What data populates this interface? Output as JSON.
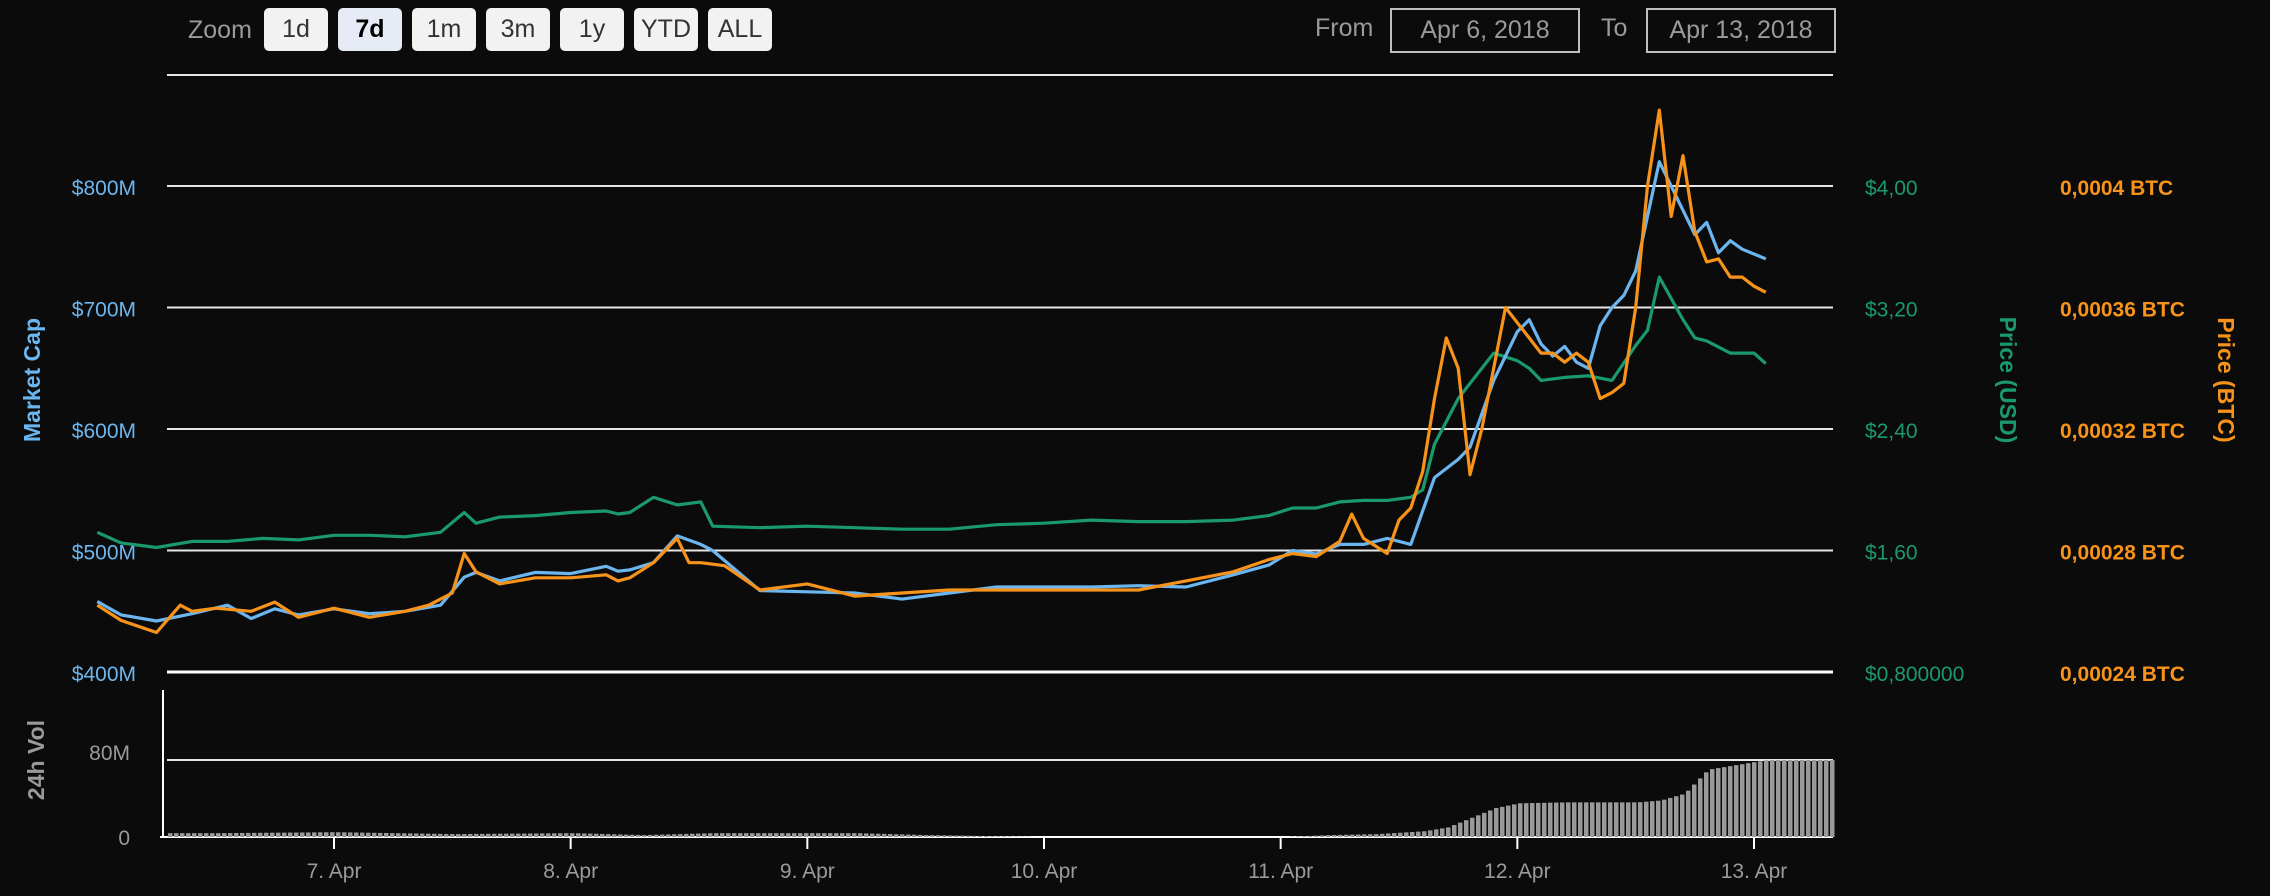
{
  "toolbar": {
    "zoom_label": "Zoom",
    "zoom_buttons": [
      "1d",
      "7d",
      "1m",
      "3m",
      "1y",
      "YTD",
      "ALL"
    ],
    "active_zoom": "7d",
    "from_label": "From",
    "from_value": "Apr 6, 2018",
    "to_label": "To",
    "to_value": "Apr 13, 2018"
  },
  "colors": {
    "market_cap": "#6cb6f0",
    "price_usd": "#1a9a6c",
    "price_btc": "#f7931a",
    "volume": "#9a9a9a",
    "grid": "#e6e6e6",
    "background": "#0b0b0b"
  },
  "chart_data": [
    {
      "type": "line",
      "x_labels": [
        "7. Apr",
        "8. Apr",
        "9. Apr",
        "10. Apr",
        "11. Apr",
        "12. Apr",
        "13. Apr"
      ],
      "x_range": [
        "Apr 6, 2018 07:00",
        "Apr 13, 2018 08:00"
      ],
      "axes": {
        "market_cap": {
          "label": "Market Cap",
          "ticks": [
            "$400M",
            "$500M",
            "$600M",
            "$700M",
            "$800M"
          ],
          "range": [
            400,
            900
          ],
          "unit": "M USD"
        },
        "price_usd": {
          "label": "Price (USD)",
          "ticks": [
            "$0,800000",
            "$1,60",
            "$2,40",
            "$3,20",
            "$4,00"
          ],
          "range": [
            0.8,
            4.8
          ]
        },
        "price_btc": {
          "label": "Price (BTC)",
          "ticks": [
            "0,00024 BTC",
            "0,00028 BTC",
            "0,00032 BTC",
            "0,00036 BTC",
            "0,0004 BTC"
          ],
          "range": [
            0.00024,
            0.00044
          ]
        }
      },
      "series": [
        {
          "name": "Market Cap",
          "key": "market_cap",
          "x": [
            0,
            0.1,
            0.25,
            0.4,
            0.55,
            0.65,
            0.75,
            0.85,
            1.0,
            1.15,
            1.3,
            1.45,
            1.55,
            1.6,
            1.7,
            1.85,
            2.0,
            2.15,
            2.2,
            2.25,
            2.35,
            2.45,
            2.55,
            2.6,
            2.8,
            3.0,
            3.2,
            3.4,
            3.6,
            3.8,
            4.0,
            4.2,
            4.4,
            4.6,
            4.8,
            4.95,
            5.05,
            5.15,
            5.25,
            5.35,
            5.45,
            5.55,
            5.65,
            5.75,
            5.8,
            5.9,
            6.0,
            6.05,
            6.1,
            6.15,
            6.2,
            6.25,
            6.3,
            6.35,
            6.4,
            6.45,
            6.5,
            6.6,
            6.7,
            6.75,
            6.8,
            6.85,
            6.9,
            6.95,
            7.0,
            7.05
          ],
          "values": [
            458,
            447,
            442,
            448,
            455,
            444,
            452,
            447,
            452,
            448,
            450,
            455,
            478,
            482,
            475,
            482,
            481,
            487,
            483,
            484,
            490,
            512,
            505,
            500,
            467,
            466,
            465,
            460,
            465,
            470,
            470,
            470,
            471,
            470,
            480,
            488,
            500,
            497,
            505,
            505,
            510,
            505,
            560,
            575,
            585,
            640,
            680,
            690,
            670,
            660,
            668,
            655,
            650,
            685,
            700,
            710,
            730,
            820,
            780,
            760,
            770,
            745,
            755,
            748,
            744,
            740
          ]
        },
        {
          "name": "Price (USD)",
          "key": "price_usd",
          "x": [
            0,
            0.1,
            0.25,
            0.4,
            0.55,
            0.7,
            0.85,
            1.0,
            1.15,
            1.3,
            1.45,
            1.55,
            1.6,
            1.7,
            1.85,
            2.0,
            2.15,
            2.2,
            2.25,
            2.35,
            2.45,
            2.55,
            2.6,
            2.8,
            3.0,
            3.2,
            3.4,
            3.6,
            3.8,
            4.0,
            4.2,
            4.4,
            4.6,
            4.8,
            4.95,
            5.05,
            5.15,
            5.25,
            5.35,
            5.45,
            5.55,
            5.6,
            5.65,
            5.75,
            5.8,
            5.9,
            6.0,
            6.05,
            6.1,
            6.2,
            6.3,
            6.4,
            6.5,
            6.55,
            6.6,
            6.7,
            6.75,
            6.8,
            6.9,
            7.0,
            7.05
          ],
          "values": [
            1.72,
            1.65,
            1.62,
            1.66,
            1.66,
            1.68,
            1.67,
            1.7,
            1.7,
            1.69,
            1.72,
            1.85,
            1.78,
            1.82,
            1.83,
            1.85,
            1.86,
            1.84,
            1.85,
            1.95,
            1.9,
            1.92,
            1.76,
            1.75,
            1.76,
            1.75,
            1.74,
            1.74,
            1.77,
            1.78,
            1.8,
            1.79,
            1.79,
            1.8,
            1.83,
            1.88,
            1.88,
            1.92,
            1.93,
            1.93,
            1.95,
            2.0,
            2.3,
            2.6,
            2.7,
            2.9,
            2.85,
            2.8,
            2.72,
            2.74,
            2.75,
            2.72,
            2.95,
            3.05,
            3.4,
            3.12,
            3.0,
            2.98,
            2.9,
            2.9,
            2.83
          ]
        },
        {
          "name": "Price (BTC)",
          "key": "price_btc",
          "x": [
            0,
            0.1,
            0.25,
            0.35,
            0.4,
            0.5,
            0.65,
            0.75,
            0.85,
            1.0,
            1.15,
            1.3,
            1.4,
            1.5,
            1.55,
            1.6,
            1.7,
            1.85,
            2.0,
            2.15,
            2.2,
            2.25,
            2.35,
            2.45,
            2.5,
            2.55,
            2.65,
            2.8,
            3.0,
            3.2,
            3.4,
            3.6,
            3.8,
            4.0,
            4.2,
            4.4,
            4.6,
            4.8,
            4.95,
            5.05,
            5.15,
            5.25,
            5.3,
            5.35,
            5.45,
            5.5,
            5.55,
            5.6,
            5.65,
            5.7,
            5.75,
            5.8,
            5.85,
            5.9,
            5.95,
            6.0,
            6.05,
            6.1,
            6.15,
            6.2,
            6.25,
            6.3,
            6.35,
            6.4,
            6.45,
            6.5,
            6.55,
            6.6,
            6.65,
            6.7,
            6.75,
            6.8,
            6.85,
            6.9,
            6.95,
            7.0,
            7.05
          ],
          "values": [
            0.000262,
            0.000257,
            0.000253,
            0.000262,
            0.00026,
            0.000261,
            0.00026,
            0.000263,
            0.000258,
            0.000261,
            0.000258,
            0.00026,
            0.000262,
            0.000266,
            0.000279,
            0.000273,
            0.000269,
            0.000271,
            0.000271,
            0.000272,
            0.00027,
            0.000271,
            0.000276,
            0.000284,
            0.000276,
            0.000276,
            0.000275,
            0.000267,
            0.000269,
            0.000265,
            0.000266,
            0.000267,
            0.000267,
            0.000267,
            0.000267,
            0.000267,
            0.00027,
            0.000273,
            0.000277,
            0.000279,
            0.000278,
            0.000283,
            0.000292,
            0.000284,
            0.000279,
            0.00029,
            0.000294,
            0.000306,
            0.00033,
            0.00035,
            0.00034,
            0.000305,
            0.00032,
            0.00034,
            0.00036,
            0.000355,
            0.00035,
            0.000345,
            0.000345,
            0.000342,
            0.000345,
            0.000342,
            0.00033,
            0.000332,
            0.000335,
            0.00036,
            0.0004,
            0.000425,
            0.00039,
            0.00041,
            0.000385,
            0.000375,
            0.000376,
            0.00037,
            0.00037,
            0.000367,
            0.000365
          ]
        }
      ]
    },
    {
      "type": "bar",
      "ylabel": "24h Vol",
      "ticks": [
        "0",
        "80M"
      ],
      "range": [
        0,
        100
      ],
      "unit": "M USD",
      "x": [
        0.05,
        0.5,
        1.0,
        1.5,
        2.0,
        2.3,
        2.6,
        3.0,
        3.2,
        3.5,
        4.0,
        4.5,
        5.0,
        5.2,
        5.4,
        5.6,
        5.7,
        5.8,
        5.9,
        6.0,
        6.2,
        6.5,
        6.6,
        6.7,
        6.8,
        7.0,
        7.05
      ],
      "values": [
        4,
        4,
        5,
        3,
        4,
        2,
        4,
        4,
        4,
        2,
        0,
        0,
        0,
        2,
        3,
        6,
        10,
        20,
        30,
        35,
        36,
        36,
        38,
        45,
        70,
        78,
        80
      ]
    }
  ]
}
